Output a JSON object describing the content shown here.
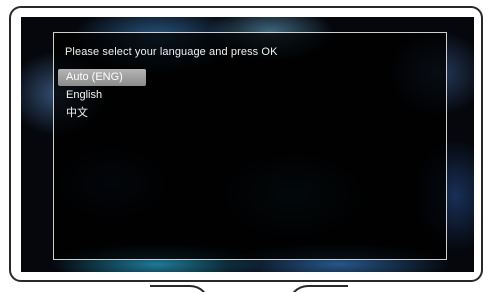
{
  "menu": {
    "prompt": "Please select your language and press OK",
    "options": [
      {
        "label": "Auto (ENG)",
        "selected": true
      },
      {
        "label": "English",
        "selected": false
      },
      {
        "label": "中文",
        "selected": false
      }
    ]
  },
  "colors": {
    "selection": "#a0a0a0",
    "panel_border": "#cfcfcf",
    "text": "#f2f2f2"
  }
}
